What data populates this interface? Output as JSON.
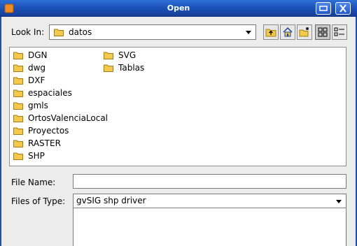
{
  "window": {
    "title": "Open",
    "titlebar_color": "#1a4fb4",
    "buttons": [
      "minimize-icon",
      "close-icon"
    ]
  },
  "look_in": {
    "label": "Look In:",
    "value": "datos"
  },
  "toolbar": {
    "icons": [
      "up-folder-icon",
      "home-icon",
      "new-folder-icon",
      "list-view-icon",
      "details-view-icon"
    ],
    "active": "list-view-icon"
  },
  "files": {
    "column1": [
      "DGN",
      "dwg",
      "DXF",
      "espaciales",
      "gmls",
      "OrtosValenciaLocal",
      "Proyectos",
      "RASTER",
      "SHP"
    ],
    "column2": [
      "SVG",
      "Tablas"
    ],
    "folder_color": "#f2c94c"
  },
  "file_name": {
    "label": "File Name:",
    "value": ""
  },
  "files_of_type": {
    "label": "Files of Type:",
    "value": "gvSIG shp driver"
  }
}
